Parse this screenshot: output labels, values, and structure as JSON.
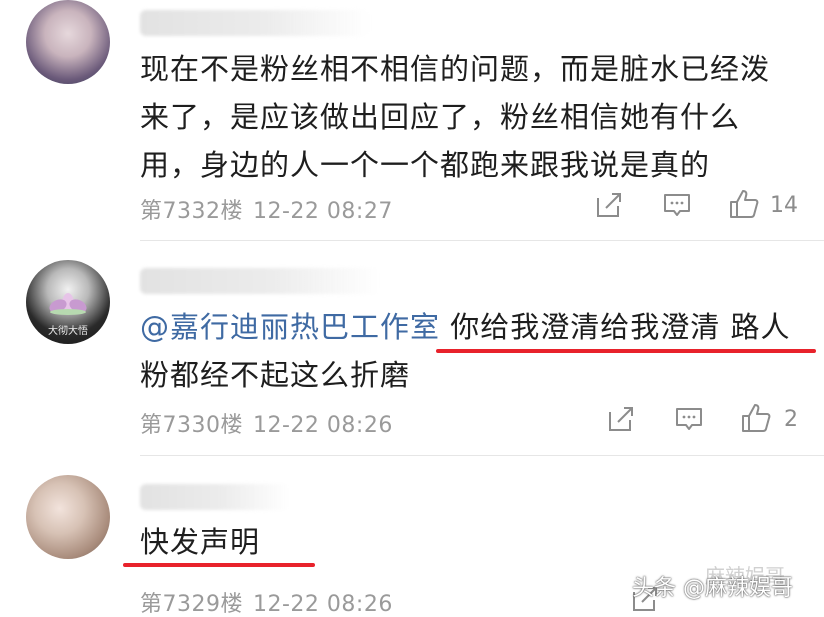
{
  "comments": [
    {
      "text": "现在不是粉丝相不相信的问题，而是脏水已经泼来了，是应该做出回应了，粉丝相信她有什么用，身边的人一个一个都跑来跟我说是真的",
      "lines": [
        "现在不是粉丝相不相信的问题，而是脏水已经泼",
        "来了，是应该做出回应了，粉丝相信她有什么",
        "用，身边的人一个一个都跑来跟我说是真的"
      ],
      "floor": "第7332楼",
      "time": "12-22 08:27",
      "likes": "14"
    },
    {
      "mention": "@嘉行迪丽热巴工作室",
      "text_line1_rest": " 你给我澄清给我澄清 路人",
      "text_line2": "粉都经不起这么折磨",
      "avatar_caption": "大彻大悟",
      "floor": "第7330楼",
      "time": "12-22 08:26",
      "likes": "2"
    },
    {
      "text": "快发声明",
      "floor": "第7329楼",
      "time": "12-22 08:26"
    }
  ],
  "icons": {
    "share": "share-icon",
    "reply": "comment-icon",
    "like": "thumbs-up-icon"
  },
  "colors": {
    "mention": "#3f6aa3",
    "underline": "#e8222b",
    "meta": "#9a9a9a"
  },
  "watermark": {
    "text": "头条 @麻辣娱哥",
    "ghost_text": "麻辣娱哥"
  }
}
